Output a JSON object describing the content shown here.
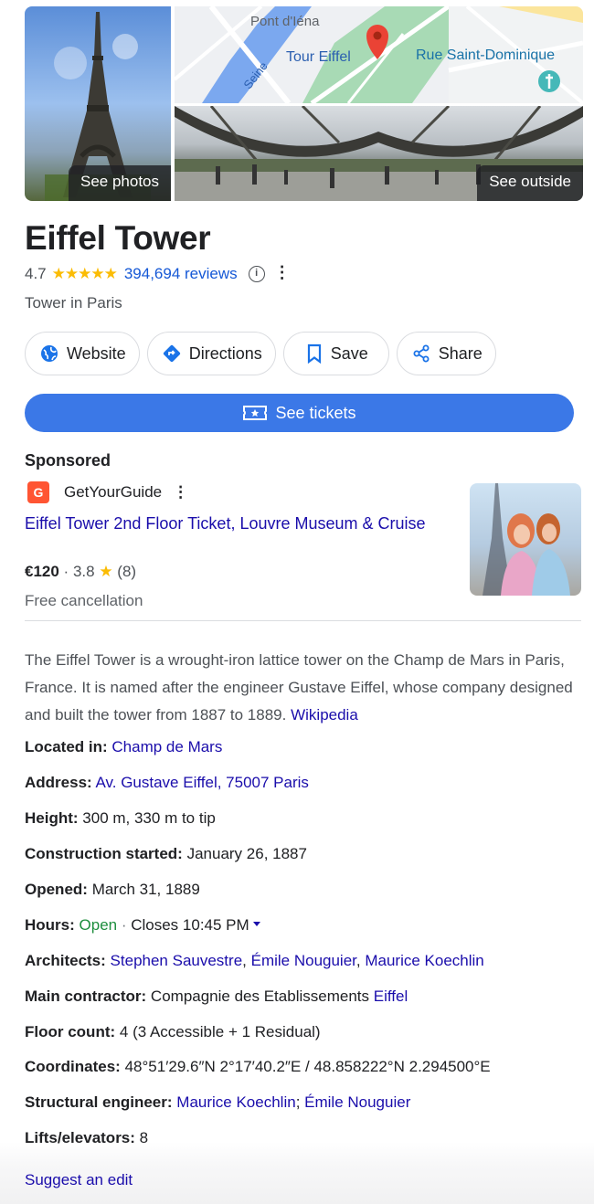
{
  "gallery": {
    "photos_label": "See photos",
    "outside_label": "See outside",
    "map_labels": {
      "bridge": "Pont d'Iéna",
      "river": "Seine",
      "place": "Tour Eiffel",
      "street": "Rue Saint-Dominique"
    }
  },
  "place": {
    "title": "Eiffel Tower",
    "rating": "4.7",
    "stars": "★★★★★",
    "reviews": "394,694 reviews",
    "info_glyph": "i",
    "more_glyph": "⋮",
    "category": "Tower in Paris"
  },
  "actions": {
    "website": "Website",
    "directions": "Directions",
    "save": "Save",
    "share": "Share",
    "tickets": "See tickets"
  },
  "ad": {
    "sponsored": "Sponsored",
    "advertiser": "GetYourGuide",
    "logo_letter": "G",
    "more_glyph": "⋮",
    "title": "Eiffel Tower 2nd Floor Ticket, Louvre Museum & Cruise",
    "price": "€120",
    "sep": " · ",
    "rating": "3.8",
    "star": "★",
    "count": "(8)",
    "cancellation": "Free cancellation"
  },
  "description": {
    "text": "The Eiffel Tower is a wrought-iron lattice tower on the Champ de Mars in Paris, France. It is named after the engineer Gustave Eiffel, whose company designed and built the tower from 1887 to 1889.",
    "source": "Wikipedia"
  },
  "facts": {
    "located_in": {
      "label": "Located in:",
      "value": "Champ de Mars"
    },
    "address": {
      "label": "Address:",
      "value": "Av. Gustave Eiffel, 75007 Paris"
    },
    "height": {
      "label": "Height:",
      "value": "300 m, 330 m to tip"
    },
    "construction_started": {
      "label": "Construction started:",
      "value": "January 26, 1887"
    },
    "opened": {
      "label": "Opened:",
      "value": "March 31, 1889"
    },
    "hours": {
      "label": "Hours:",
      "status": "Open",
      "sep": " · ",
      "value": "Closes 10:45 PM"
    },
    "architects": {
      "label": "Architects:",
      "names": [
        "Stephen Sauvestre",
        "Émile Nouguier",
        "Maurice Koechlin"
      ],
      "sep": ", "
    },
    "main_contractor": {
      "label": "Main contractor:",
      "value": "Compagnie des Etablissements",
      "link": "Eiffel"
    },
    "floor_count": {
      "label": "Floor count:",
      "value": "4 (3 Accessible + 1 Residual)"
    },
    "coordinates": {
      "label": "Coordinates:",
      "value": "48°51′29.6″N 2°17′40.2″E / 48.858222°N 2.294500°E"
    },
    "structural_engineer": {
      "label": "Structural engineer:",
      "names": [
        "Maurice Koechlin",
        "Émile Nouguier"
      ],
      "sep": "; "
    },
    "lifts": {
      "label": "Lifts/elevators:",
      "value": "8"
    }
  },
  "footer": {
    "suggest_edit": "Suggest an edit"
  },
  "colors": {
    "accent": "#3b78e7",
    "link": "#1a0dab",
    "star": "#fbbc04",
    "open": "#1e8e3e",
    "ad_brand": "#ff5533"
  }
}
